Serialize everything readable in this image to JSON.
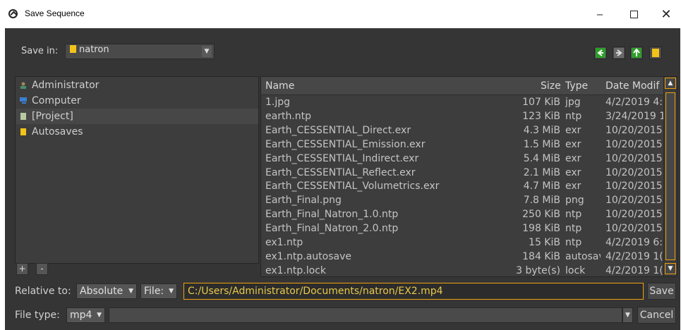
{
  "window": {
    "title": "Save Sequence",
    "minimize_glyph": "–",
    "close_glyph": "✕"
  },
  "toolbar": {
    "save_in_label": "Save in:",
    "save_in_value": "natron",
    "icons": [
      "back-arrow-icon",
      "forward-arrow-icon",
      "up-arrow-icon",
      "new-folder-icon"
    ]
  },
  "sidebar": {
    "items": [
      {
        "label": "Administrator",
        "icon": "user-icon"
      },
      {
        "label": "Computer",
        "icon": "computer-icon"
      },
      {
        "label": "[Project]",
        "icon": "project-icon"
      },
      {
        "label": "Autosaves",
        "icon": "folder-icon"
      }
    ],
    "add_label": "+",
    "remove_label": "-"
  },
  "filelist": {
    "columns": [
      "Name",
      "Size",
      "Type",
      "Date Modif"
    ],
    "rows": [
      {
        "name": "1.jpg",
        "size": "107 KiB",
        "type": "jpg",
        "date": "4/2/2019 4:"
      },
      {
        "name": "earth.ntp",
        "size": "123 KiB",
        "type": "ntp",
        "date": "3/24/2019 1"
      },
      {
        "name": "Earth_CESSENTIAL_Direct.exr",
        "size": "4.3 MiB",
        "type": "exr",
        "date": "10/20/2015"
      },
      {
        "name": "Earth_CESSENTIAL_Emission.exr",
        "size": "1.5 MiB",
        "type": "exr",
        "date": "10/20/2015"
      },
      {
        "name": "Earth_CESSENTIAL_Indirect.exr",
        "size": "5.4 MiB",
        "type": "exr",
        "date": "10/20/2015"
      },
      {
        "name": "Earth_CESSENTIAL_Reflect.exr",
        "size": "2.1 MiB",
        "type": "exr",
        "date": "10/20/2015"
      },
      {
        "name": "Earth_CESSENTIAL_Volumetrics.exr",
        "size": "4.7 MiB",
        "type": "exr",
        "date": "10/20/2015"
      },
      {
        "name": "Earth_Final.png",
        "size": "7.8 MiB",
        "type": "png",
        "date": "10/20/2015"
      },
      {
        "name": "Earth_Final_Natron_1.0.ntp",
        "size": "250 KiB",
        "type": "ntp",
        "date": "10/20/2015"
      },
      {
        "name": "Earth_Final_Natron_2.0.ntp",
        "size": "198 KiB",
        "type": "ntp",
        "date": "10/20/2015"
      },
      {
        "name": "ex1.ntp",
        "size": "15 KiB",
        "type": "ntp",
        "date": "4/2/2019 6:"
      },
      {
        "name": "ex1.ntp.autosave",
        "size": "184 KiB",
        "type": "autosav",
        "date": "4/2/2019 1("
      },
      {
        "name": "ex1.ntp.lock",
        "size": "3 byte(s)",
        "type": "lock",
        "date": "4/2/2019 1("
      }
    ]
  },
  "footer": {
    "relative_label": "Relative to:",
    "relative_value": "Absolute",
    "file_label": "File:",
    "path_value": "C:/Users/Administrator/Documents/natron/EX2.mp4",
    "save_label": "Save",
    "filetype_label": "File type:",
    "filetype_value": "mp4",
    "cancel_label": "Cancel"
  },
  "colors": {
    "dialog_bg": "#353535",
    "accent": "#f0a20c",
    "folder": "#f2c318",
    "nav_green": "#2e9e2a"
  }
}
